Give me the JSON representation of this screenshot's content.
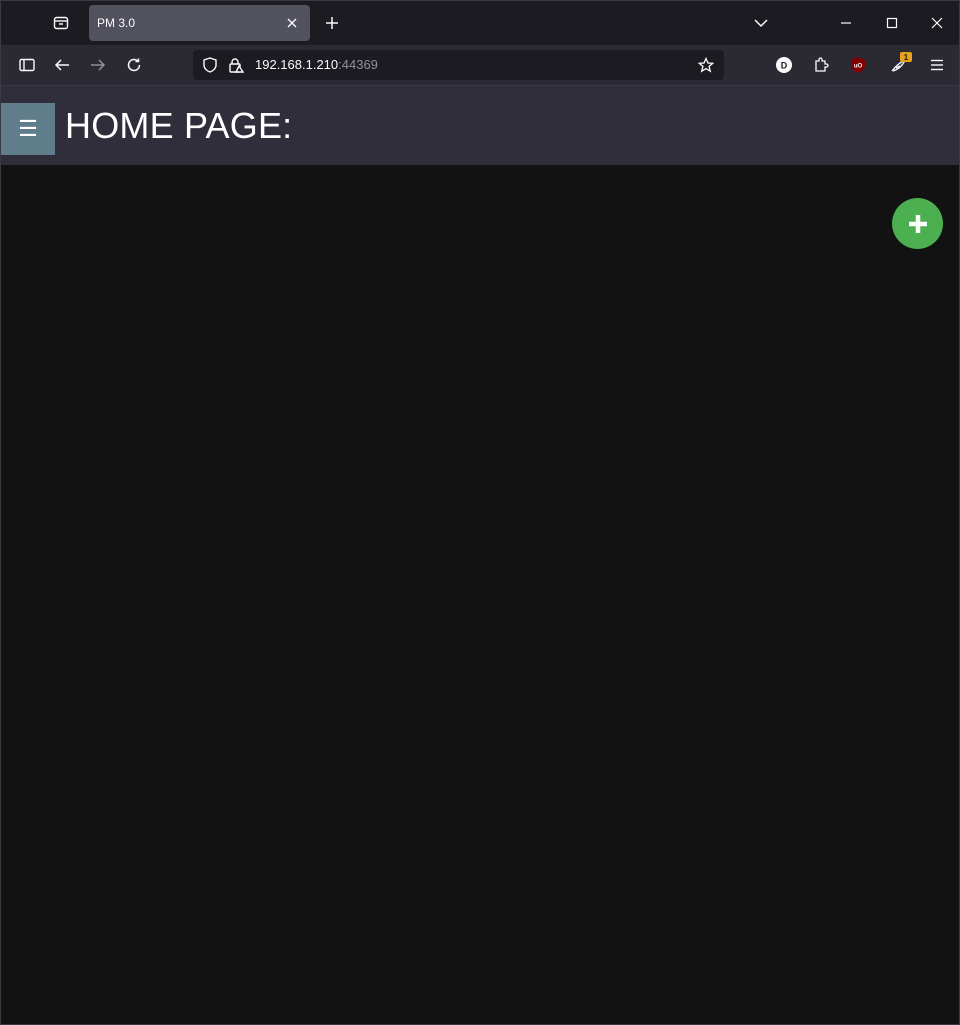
{
  "browser": {
    "tab": {
      "title": "PM 3.0"
    },
    "url": {
      "host": "192.168.1.210",
      "port": ":44369"
    },
    "extensions": {
      "d_label": "D",
      "ublock_label": "uO",
      "badge_count": "1"
    }
  },
  "app": {
    "menu_label": "☰",
    "page_title": "HOME PAGE:"
  },
  "colors": {
    "accent_fab": "#4caf50",
    "menu_button": "#607d8b",
    "header": "#2f2e3a",
    "background": "#121212"
  },
  "icons": {
    "fab": "plus-icon",
    "menu": "hamburger-icon"
  }
}
